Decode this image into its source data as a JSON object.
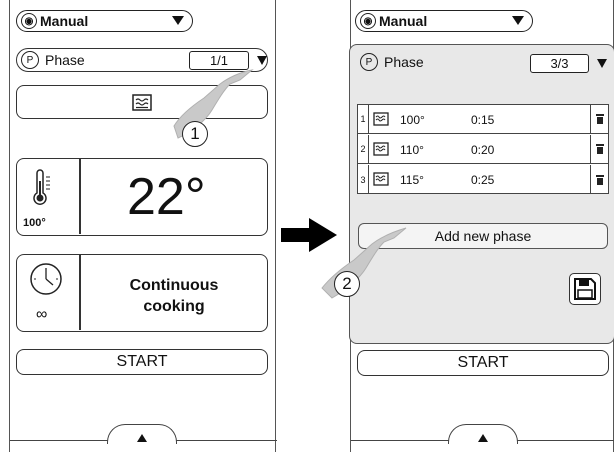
{
  "left_screen": {
    "mode_label": "Manual",
    "phase_label": "Phase",
    "phase_count": "1/1",
    "temp_setpoint": "100°",
    "temp_value": "22°",
    "cooking_mode_line1": "Continuous",
    "cooking_mode_line2": "cooking",
    "duration_symbol": "∞",
    "start_label": "START",
    "callout_number": "1"
  },
  "right_screen": {
    "mode_label": "Manual",
    "phase_label": "Phase",
    "phase_count": "3/3",
    "steps": [
      {
        "num": "1",
        "temp": "100°",
        "time": "0:15"
      },
      {
        "num": "2",
        "temp": "110°",
        "time": "0:20"
      },
      {
        "num": "3",
        "temp": "115°",
        "time": "0:25"
      }
    ],
    "add_phase_label": "Add new phase",
    "start_label": "START",
    "callout_number": "2"
  },
  "icons": {
    "mode": "power-mode-icon",
    "phase": "phase-p-icon",
    "steam": "steam-icon",
    "thermometer": "thermometer-icon",
    "clock": "clock-icon",
    "delete": "trash-icon",
    "save": "floppy-save-icon",
    "transition": "arrow-right-icon",
    "hand": "pointing-hand-icon"
  }
}
